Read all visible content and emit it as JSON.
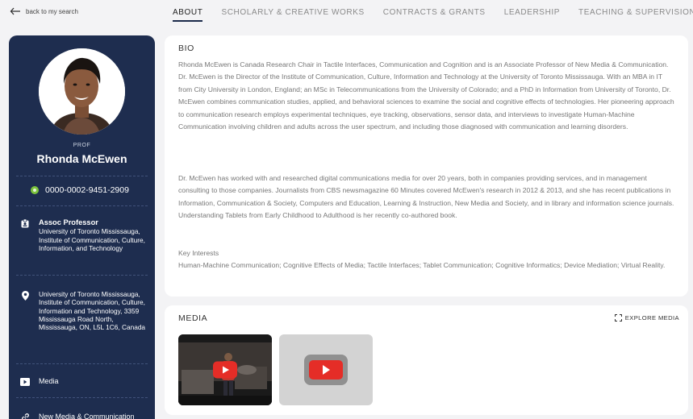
{
  "nav": {
    "back_label": "back to my search",
    "tabs": [
      {
        "label": "ABOUT",
        "active": true
      },
      {
        "label": "SCHOLARLY & CREATIVE WORKS",
        "active": false
      },
      {
        "label": "CONTRACTS & GRANTS",
        "active": false
      },
      {
        "label": "LEADERSHIP",
        "active": false
      },
      {
        "label": "TEACHING & SUPERVISION",
        "active": false
      }
    ]
  },
  "profile": {
    "prefix": "PROF",
    "name": "Rhonda McEwen",
    "orcid": "0000-0002-9451-2909",
    "position_title": "Assoc Professor",
    "position_org": "University of Toronto Mississauga, Institute of Communication, Culture, Information, and Technology",
    "address": "University of Toronto Mississauga, Institute of Communication, Culture, Information and Technology, 3359 Mississauga Road North, Mississauga, ON, L5L 1C6, Canada",
    "media_link": "Media",
    "dept_link": "New Media & Communication"
  },
  "bio": {
    "title": "BIO",
    "paragraph1": "Rhonda McEwen is Canada Research Chair in Tactile Interfaces, Communication and Cognition and is an Associate Professor of New Media & Communication. Dr. McEwen is the Director of the Institute of Communication, Culture, Information and Technology at the University of Toronto Mississauga. With an MBA in IT from City University in London, England; an MSc in Telecommunications from the University of Colorado; and a PhD in Information from University of Toronto, Dr. McEwen combines communication studies, applied, and behavioral sciences to examine the social and cognitive effects of technologies. Her pioneering approach to communication research employs experimental techniques, eye tracking, observations, sensor data, and interviews to investigate Human-Machine Communication involving children and adults across the user spectrum, and including those diagnosed with communication and learning disorders.",
    "paragraph2": "Dr. McEwen has worked with and researched digital communications media for over 20 years, both in companies providing services, and in management consulting to those companies. Journalists from CBS newsmagazine 60 Minutes covered McEwen's research in 2012 & 2013, and she has recent publications in Information, Communication & Society, Computers and Education, Learning & Instruction, New Media and Society, and in library and information science journals. Understanding Tablets from Early Childhood to Adulthood is her recently co-authored book.",
    "interests_heading": "Key Interests",
    "interests": "Human-Machine Communication; Cognitive Effects of Media; Tactile Interfaces; Tablet Communication; Cognitive Informatics; Device Mediation; Virtual Reality."
  },
  "media": {
    "title": "MEDIA",
    "explore_label": "EXPLORE MEDIA"
  },
  "colors": {
    "sidebar_bg": "#1e2d4f",
    "orcid_green": "#7cc33c",
    "youtube_red": "#e52d27"
  },
  "icons": [
    "back-arrow-icon",
    "orcid-icon",
    "badge-icon",
    "location-pin-icon",
    "media-icon",
    "link-icon",
    "expand-icon",
    "youtube-play-icon"
  ]
}
